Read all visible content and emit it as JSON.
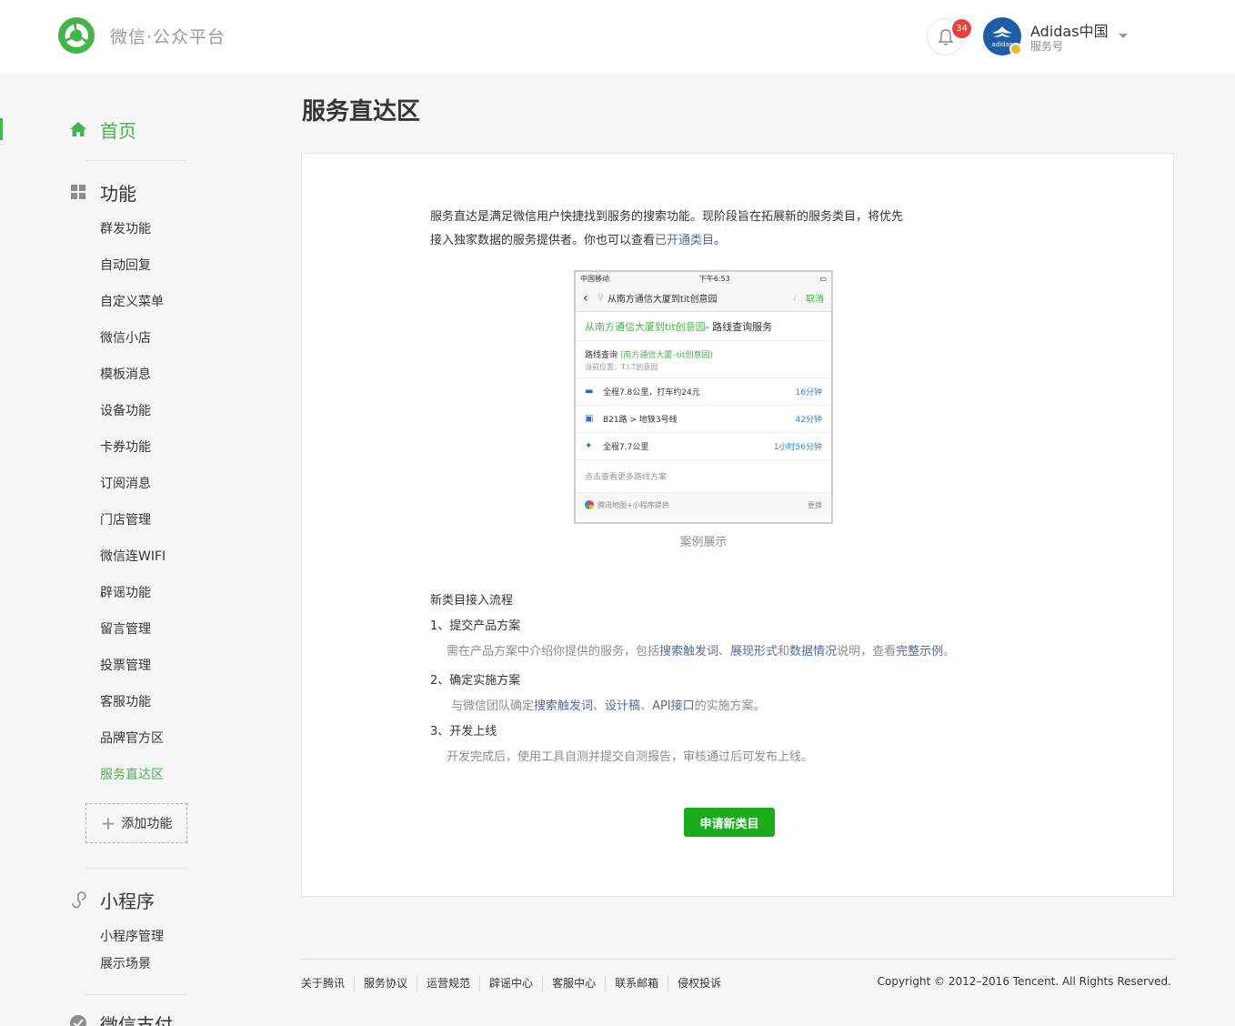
{
  "header": {
    "brand": "微信·公众平台",
    "notification_count": "34",
    "account_name": "Adidas中国",
    "account_type": "服务号",
    "avatar_text": "adidas"
  },
  "sidebar": {
    "home": "首页",
    "features": "功能",
    "feature_items": [
      "群发功能",
      "自动回复",
      "自定义菜单",
      "微信小店",
      "模板消息",
      "设备功能",
      "卡券功能",
      "订阅消息",
      "门店管理",
      "微信连WIFI",
      "辟谣功能",
      "留言管理",
      "投票管理",
      "客服功能",
      "品牌官方区",
      "服务直达区"
    ],
    "add_feature": "添加功能",
    "miniprogram": "小程序",
    "miniprogram_items": [
      "小程序管理",
      "展示场景"
    ],
    "wechat_pay": "微信支付"
  },
  "main": {
    "title": "服务直达区",
    "intro_line1": "服务直达是满足微信用户快捷找到服务的搜索功能。现阶段旨在拓展新的服务类目，将优先",
    "intro_line2": "接入独家数据的服务提供者。你也可以查看",
    "intro_link": "已开通类目",
    "intro_end": "。",
    "phone": {
      "carrier": "中国移动",
      "time": "下午6:53",
      "query": "从南方通信大厦到tit创意园",
      "cancel": "取消",
      "head_green": "从南方通信大厦到tit创意园",
      "head_rest": " - 路线查询服务",
      "route_label": "路线查询",
      "route_detail": "(南方通信大厦–tit创意园)",
      "location": "当前位置：T.I.T创意园",
      "routes": [
        {
          "text": "全程7.8公里，打车约24元",
          "time": "16分钟"
        },
        {
          "text": "B21路 > 地铁3号线",
          "time": "42分钟"
        },
        {
          "text": "全程7.7公里",
          "time": "1小时56分钟"
        }
      ],
      "more": "点击查看更多路线方案",
      "provider": "腾讯地图+小程序提供",
      "change": "更换"
    },
    "caption": "案例展示",
    "flow_title": "新类目接入流程",
    "step1_title": "1、提交产品方案",
    "step1_a": "需在产品方案中介绍你提供的服务，包括",
    "step1_link1": "搜索触发词",
    "step1_sep1": "、",
    "step1_link2": "展现形式",
    "step1_and": "和",
    "step1_link3": "数据情况",
    "step1_b": "说明，查看",
    "step1_link4": "完整示例",
    "step1_end": "。",
    "step2_title": "2、确定实施方案",
    "step2_a": "与微信团队确定",
    "step2_link1": "搜索触发词",
    "step2_sep1": "、",
    "step2_link2": "设计稿",
    "step2_sep2": "、",
    "step2_link3": "API接口",
    "step2_b": "的实施方案。",
    "step3_title": "3、开发上线",
    "step3_desc": "开发完成后，使用工具自测并提交自测报告，审核通过后可发布上线。",
    "apply_button": "申请新类目"
  },
  "footer": {
    "links": [
      "关于腾讯",
      "服务协议",
      "运营规范",
      "辟谣中心",
      "客服中心",
      "联系邮箱",
      "侵权投诉"
    ],
    "copyright": "Copyright © 2012–2016 Tencent. All Rights Reserved."
  },
  "colors": {
    "brand_green": "#44b549",
    "button_green": "#1aad19",
    "link_blue": "#576b95",
    "badge_red": "#e64340"
  }
}
